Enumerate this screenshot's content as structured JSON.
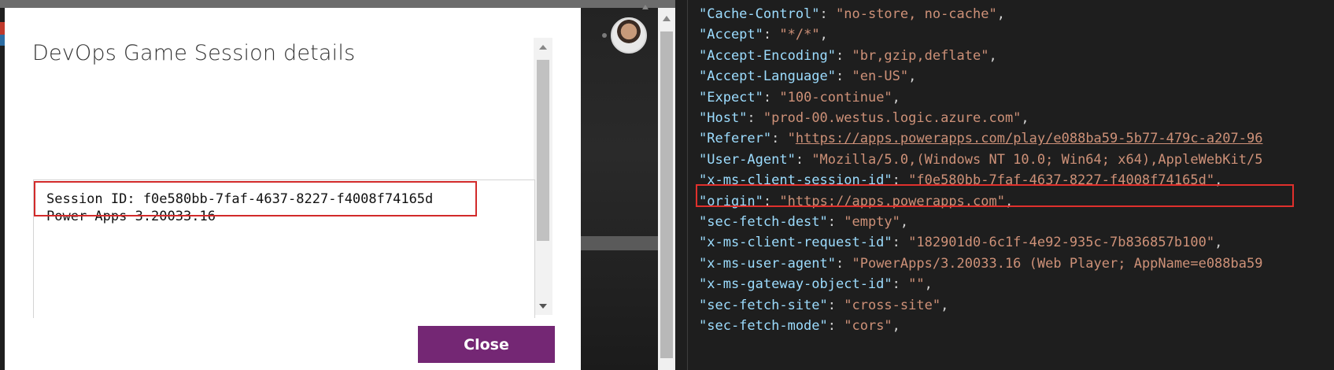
{
  "dialog": {
    "title": "DevOps Game Session details",
    "session_line": "Session ID: f0e580bb-7faf-4637-8227-f4008f74165d",
    "version_line": "Power Apps 3.20033.16",
    "close_label": "Close"
  },
  "colors": {
    "close_button": "#742774",
    "highlight_border": "#d22a2a",
    "editor_background": "#1e1e1e",
    "json_key": "#9cdcfe",
    "json_string": "#ce9178"
  },
  "editor": {
    "lines": [
      {
        "key": "\"Cache-Control\"",
        "value": "\"no-store, no-cache\"",
        "tail": ","
      },
      {
        "key": "\"Accept\"",
        "value": "\"*/*\"",
        "tail": ","
      },
      {
        "key": "\"Accept-Encoding\"",
        "value": "\"br,gzip,deflate\"",
        "tail": ","
      },
      {
        "key": "\"Accept-Language\"",
        "value": "\"en-US\"",
        "tail": ","
      },
      {
        "key": "\"Expect\"",
        "value": "\"100-continue\"",
        "tail": ","
      },
      {
        "key": "\"Host\"",
        "value": "\"prod-00.westus.logic.azure.com\"",
        "tail": ","
      },
      {
        "key": "\"Referer\"",
        "value_prefix": "\"",
        "link": "https://apps.powerapps.com/play/e088ba59-5b77-479c-a207-96",
        "tail": ""
      },
      {
        "key": "\"User-Agent\"",
        "value": "\"Mozilla/5.0,(Windows NT 10.0; Win64; x64),AppleWebKit/5",
        "tail": ""
      },
      {
        "key": "\"x-ms-client-session-id\"",
        "value": "\"f0e580bb-7faf-4637-8227-f4008f74165d\"",
        "tail": ","
      },
      {
        "key": "\"origin\"",
        "value_prefix": "\"",
        "link": "https://apps.powerapps.com",
        "value_suffix": "\"",
        "tail": ","
      },
      {
        "key": "\"sec-fetch-dest\"",
        "value": "\"empty\"",
        "tail": ","
      },
      {
        "key": "\"x-ms-client-request-id\"",
        "value": "\"182901d0-6c1f-4e92-935c-7b836857b100\"",
        "tail": ","
      },
      {
        "key": "\"x-ms-user-agent\"",
        "value": "\"PowerApps/3.20033.16 (Web Player; AppName=e088ba59",
        "tail": ""
      },
      {
        "key": "\"x-ms-gateway-object-id\"",
        "value": "\"\"",
        "tail": ","
      },
      {
        "key": "\"sec-fetch-site\"",
        "value": "\"cross-site\"",
        "tail": ","
      },
      {
        "key": "\"sec-fetch-mode\"",
        "value": "\"cors\"",
        "tail": ","
      }
    ]
  }
}
